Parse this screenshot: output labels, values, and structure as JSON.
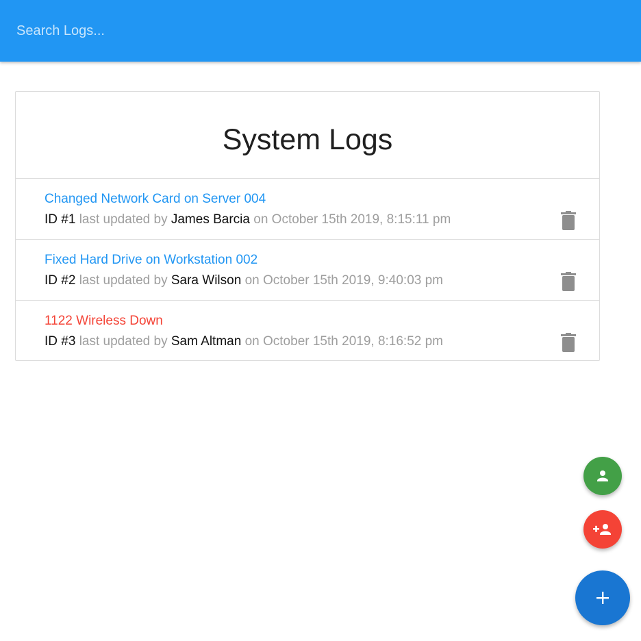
{
  "search": {
    "placeholder": "Search Logs..."
  },
  "page": {
    "title": "System Logs"
  },
  "logs": [
    {
      "message": "Changed Network Card on Server 004",
      "attention": false,
      "id_label": "ID #1",
      "updated_by_label": "last updated by",
      "tech": "James Barcia",
      "on_label": "on",
      "date": "October 15th 2019, 8:15:11 pm"
    },
    {
      "message": "Fixed Hard Drive on Workstation 002",
      "attention": false,
      "id_label": "ID #2",
      "updated_by_label": "last updated by",
      "tech": "Sara Wilson",
      "on_label": "on",
      "date": "October 15th 2019, 9:40:03 pm"
    },
    {
      "message": "1122 Wireless Down",
      "attention": true,
      "id_label": "ID #3",
      "updated_by_label": "last updated by",
      "tech": "Sam Altman",
      "on_label": "on",
      "date": "October 15th 2019, 8:16:52 pm"
    }
  ],
  "fabs": {
    "techs_icon": "person-icon",
    "add_tech_icon": "person-add-icon",
    "add_log_icon": "add-icon"
  },
  "colors": {
    "header": "#2196f3",
    "link_normal": "#2196f3",
    "link_attention": "#f44336",
    "fab_green": "#43a047",
    "fab_red": "#f44336",
    "fab_blue": "#1976d2",
    "trash": "#8e8e8e"
  }
}
